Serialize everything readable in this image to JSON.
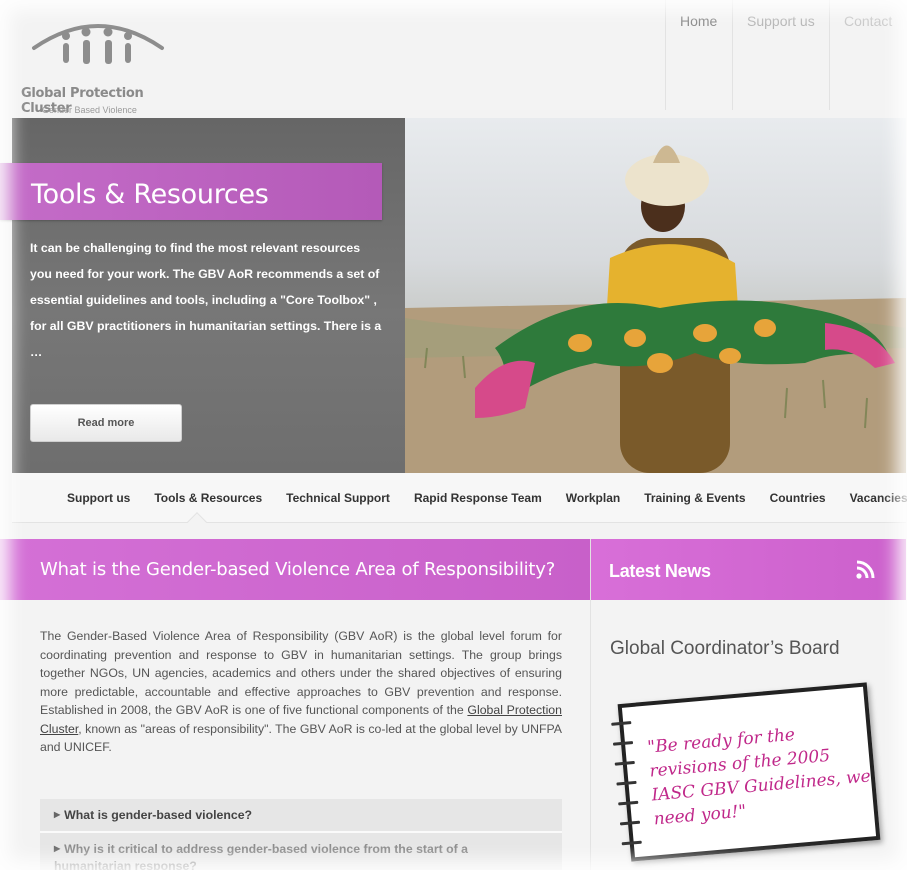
{
  "logo": {
    "title": "Global Protection Cluster",
    "subtitle": "Gender Based Violence"
  },
  "top_nav": [
    "Home",
    "Support us",
    "Contact"
  ],
  "hero": {
    "title": "Tools & Resources",
    "text": "It can be challenging to find the most relevant resources you need for your work.  The GBV AoR recommends a set of essential guidelines and tools, including a  \"Core Toolbox\" , for all GBV practitioners in humanitarian settings. There is a …",
    "button": "Read more"
  },
  "sub_nav": [
    "Support us",
    "Tools & Resources",
    "Technical Support",
    "Rapid Response Team",
    "Workplan",
    "Training & Events",
    "Countries",
    "Vacancies"
  ],
  "sub_nav_active": "Tools & Resources",
  "main": {
    "heading": "What is the Gender-based Violence Area of Responsibility?",
    "body_before_link": "The Gender-Based Violence Area of Responsibility (GBV AoR) is the global level forum for coordinating prevention and response to GBV in humanitarian settings. The group brings together NGOs, UN agencies, academics and others under the shared objectives of ensuring more predictable, accountable and effective approaches to GBV prevention and response. Established in 2008, the GBV AoR is one of five functional components of the ",
    "body_link": "Global Protection Cluster",
    "body_after_link": ", known as \"areas of responsibility\". The GBV AoR is co-led at the global level by UNFPA and UNICEF.",
    "faq": [
      "What is gender-based violence?",
      "Why is it critical to address gender-based violence from the start of a humanitarian response?"
    ]
  },
  "sidebar": {
    "heading": "Latest News",
    "subheading": "Global Coordinator’s Board",
    "note_text": "\"Be ready for the revisions of the 2005 IASC GBV Guidelines, we need you!\""
  },
  "colors": {
    "accent_purple": "#c860c9",
    "note_text": "#c0288a"
  }
}
